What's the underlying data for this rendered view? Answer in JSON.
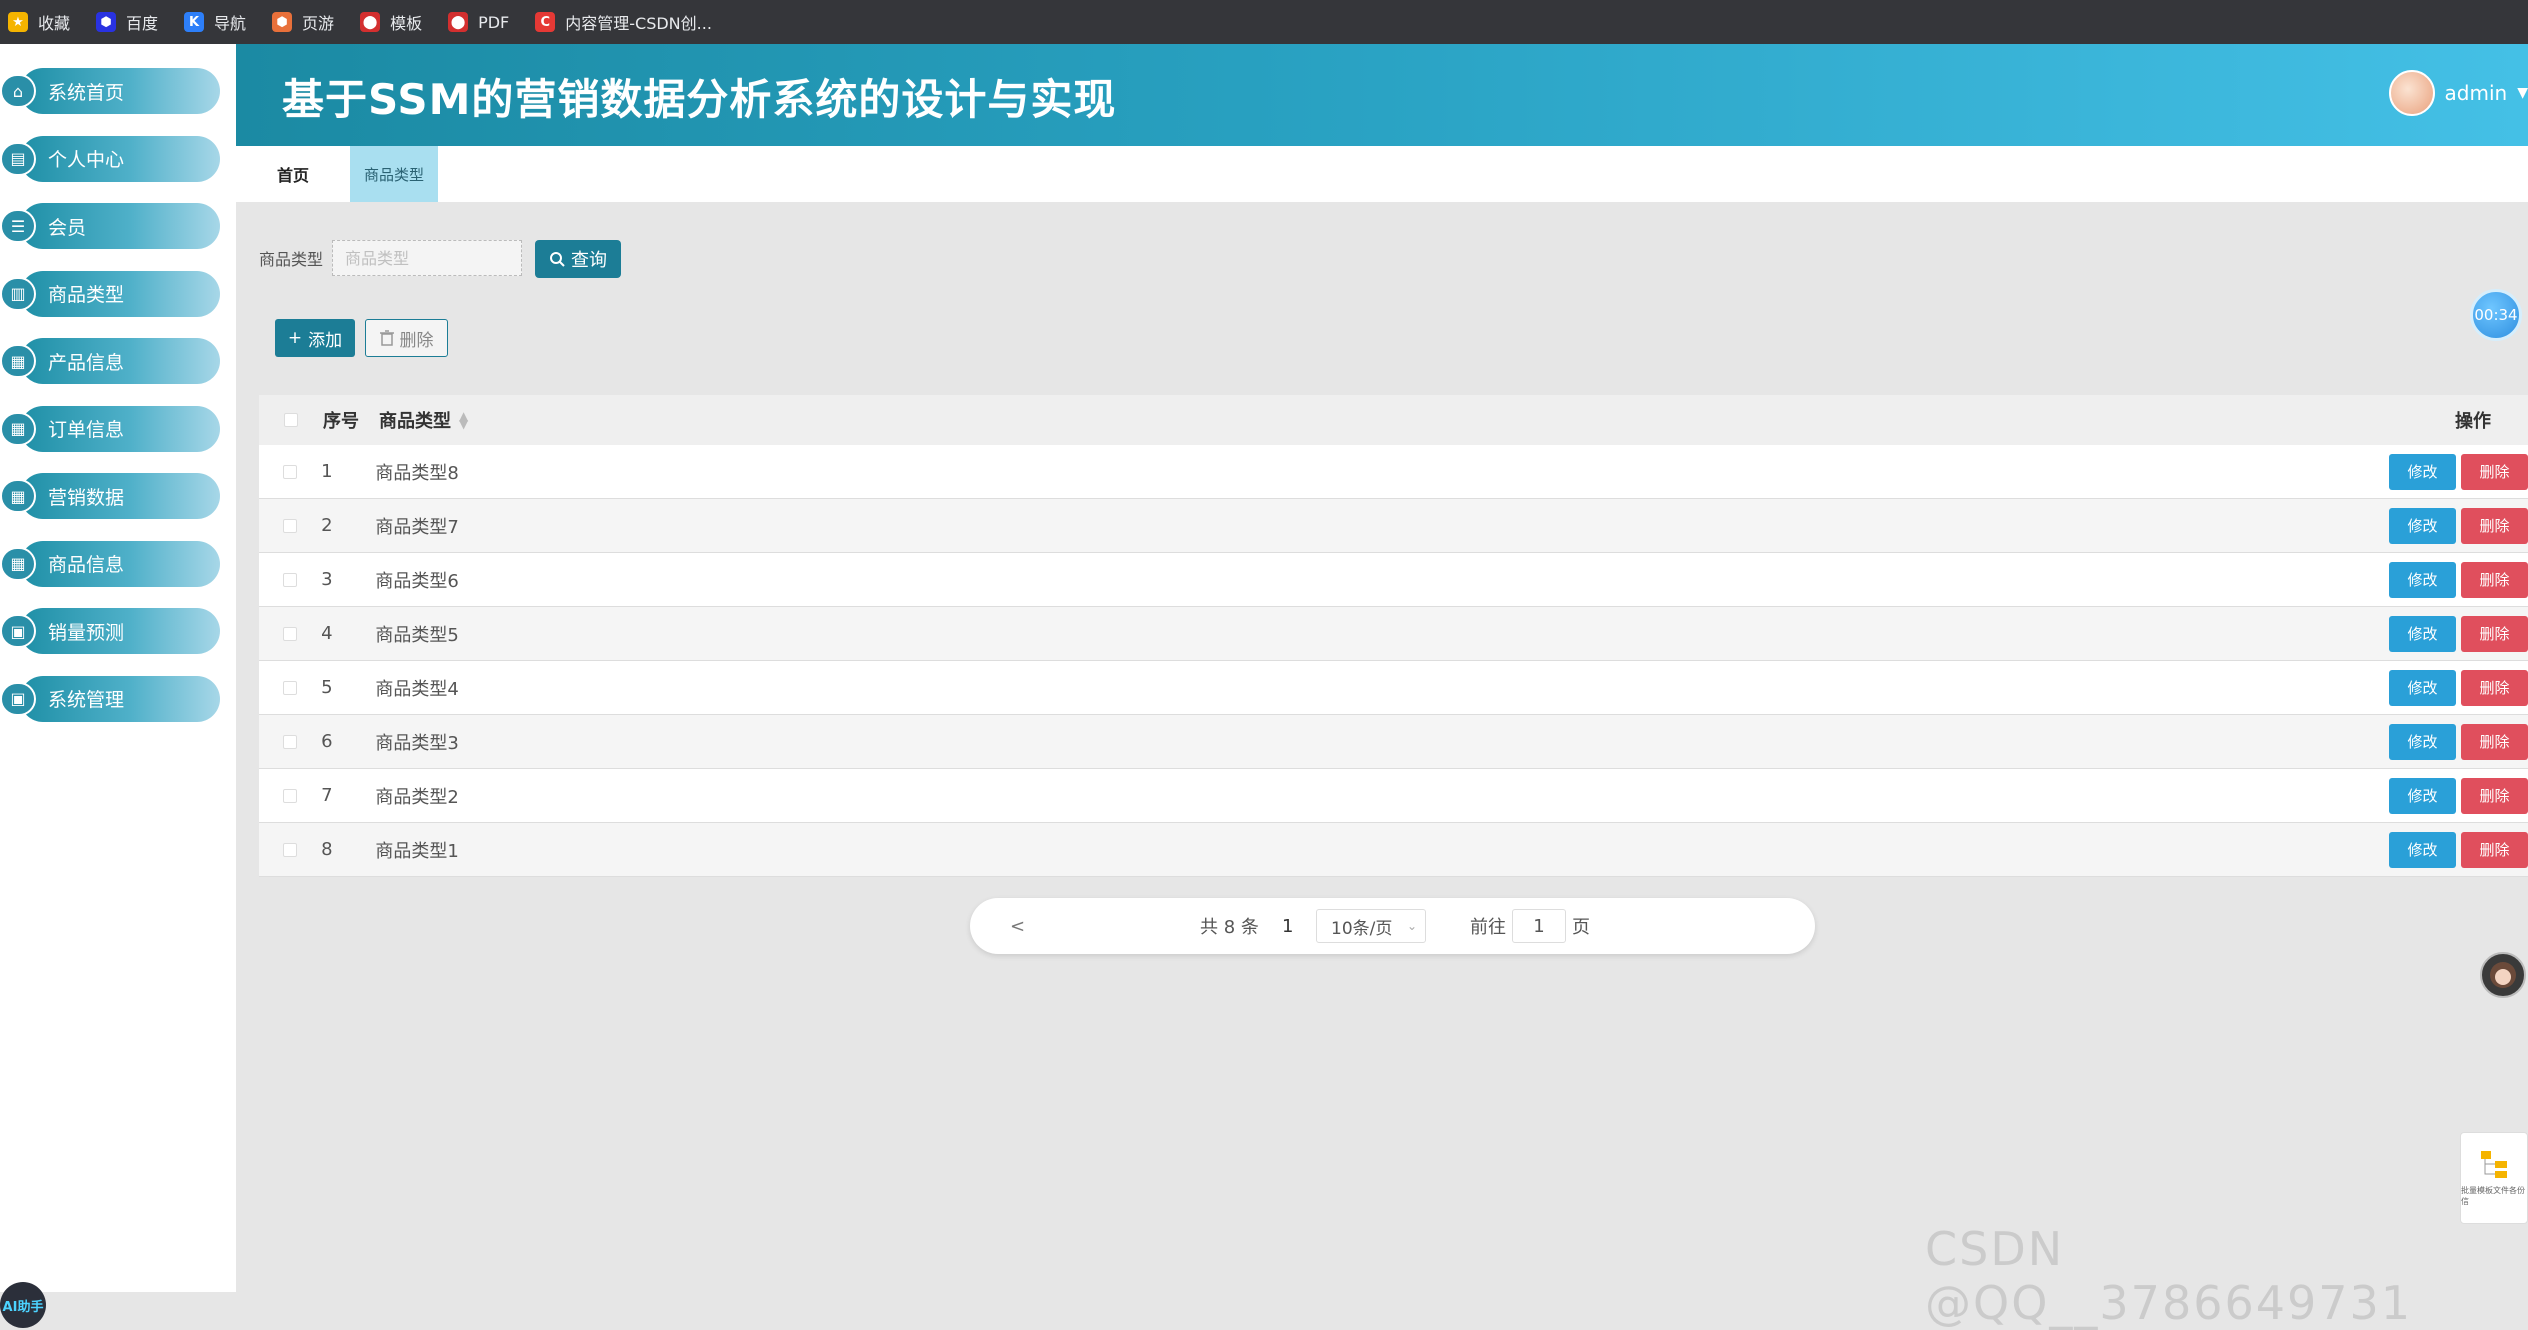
{
  "bookmarks": [
    {
      "label": "收藏",
      "icon": "star-icon",
      "color": "#f5b400"
    },
    {
      "label": "百度",
      "icon": "baidu-icon",
      "color": "#2932e1"
    },
    {
      "label": "导航",
      "icon": "k-icon",
      "color": "#2d7ff9"
    },
    {
      "label": "页游",
      "icon": "game-shield-icon",
      "color": "#e8703a"
    },
    {
      "label": "模板",
      "icon": "template-icon",
      "color": "#d32f2f"
    },
    {
      "label": "PDF",
      "icon": "pdf-icon",
      "color": "#d32f2f"
    },
    {
      "label": "内容管理-CSDN创...",
      "icon": "csdn-icon",
      "color": "#e53935"
    }
  ],
  "sidebar": {
    "items": [
      {
        "label": "系统首页",
        "icon": "home-icon"
      },
      {
        "label": "个人中心",
        "icon": "profile-icon"
      },
      {
        "label": "会员",
        "icon": "sliders-icon"
      },
      {
        "label": "商品类型",
        "icon": "bar-chart-icon"
      },
      {
        "label": "产品信息",
        "icon": "grid-icon"
      },
      {
        "label": "订单信息",
        "icon": "grid-icon"
      },
      {
        "label": "营销数据",
        "icon": "grid-icon"
      },
      {
        "label": "商品信息",
        "icon": "grid-icon"
      },
      {
        "label": "销量预测",
        "icon": "clipboard-icon"
      },
      {
        "label": "系统管理",
        "icon": "clipboard-icon"
      }
    ],
    "ai_badge": "AI助手"
  },
  "header": {
    "title": "基于SSM的营销数据分析系统的设计与实现",
    "username": "admin"
  },
  "tabs": {
    "home": "首页",
    "active": "商品类型"
  },
  "search": {
    "label": "商品类型",
    "placeholder": "商品类型",
    "button": "查询"
  },
  "actions": {
    "add": "添加",
    "delete": "删除"
  },
  "timer": "00:34",
  "table": {
    "headers": {
      "index": "序号",
      "name": "商品类型",
      "ops": "操作"
    },
    "edit_label": "修改",
    "delete_label": "删除",
    "rows": [
      {
        "index": "1",
        "name": "商品类型8"
      },
      {
        "index": "2",
        "name": "商品类型7"
      },
      {
        "index": "3",
        "name": "商品类型6"
      },
      {
        "index": "4",
        "name": "商品类型5"
      },
      {
        "index": "5",
        "name": "商品类型4"
      },
      {
        "index": "6",
        "name": "商品类型3"
      },
      {
        "index": "7",
        "name": "商品类型2"
      },
      {
        "index": "8",
        "name": "商品类型1"
      }
    ]
  },
  "pagination": {
    "prev": "<",
    "total": "共 8 条",
    "current": "1",
    "page_size": "10条/页",
    "goto_prefix": "前往",
    "goto_value": "1",
    "goto_suffix": "页"
  },
  "float_panel": "批量模板文件各份信",
  "watermark": "CSDN @QQ__3786649731",
  "colors": {
    "accent": "#1c7d96",
    "edit": "#2aa0d8",
    "delete": "#e04f5d",
    "active_tab": "#a9dff0"
  }
}
